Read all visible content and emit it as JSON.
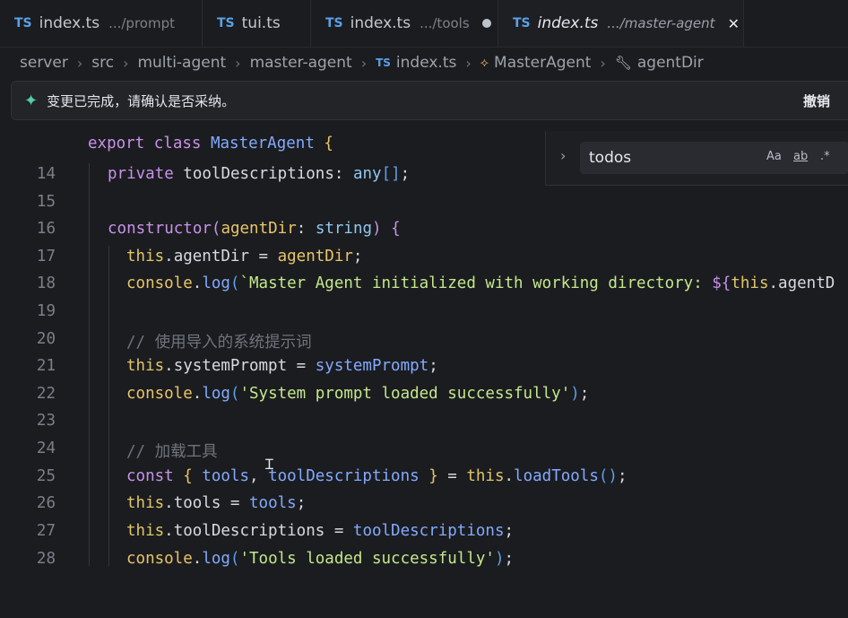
{
  "tabs": [
    {
      "name": "index.ts",
      "path": ".../prompt",
      "active": false
    },
    {
      "name": "tui.ts",
      "path": "",
      "active": false
    },
    {
      "name": "index.ts",
      "path": ".../tools",
      "active": false,
      "modified": true
    },
    {
      "name": "index.ts",
      "path": ".../master-agent",
      "active": true
    }
  ],
  "ts_badge": "TS",
  "close_glyph": "✕",
  "breadcrumb": {
    "items": [
      "server",
      "src",
      "multi-agent",
      "master-agent"
    ],
    "file": "index.ts",
    "class": "MasterAgent",
    "member": "agentDir",
    "class_icon": "symbol-class-icon",
    "member_icon": "wrench-icon"
  },
  "notice": {
    "text": "变更已完成，请确认是否采纳。",
    "undo": "撤销"
  },
  "find": {
    "query": "todos",
    "match_case": "Aa",
    "whole_word": "ab",
    "regex": ".*"
  },
  "code": {
    "sticky": "export class MasterAgent {",
    "lines": [
      {
        "n": "14",
        "text": "private toolDescriptions: any[];"
      },
      {
        "n": "15",
        "text": ""
      },
      {
        "n": "16",
        "text": "constructor(agentDir: string) {"
      },
      {
        "n": "17",
        "text": "this.agentDir = agentDir;"
      },
      {
        "n": "18",
        "text": "console.log(`Master Agent initialized with working directory: ${this.agentD"
      },
      {
        "n": "19",
        "text": ""
      },
      {
        "n": "20",
        "text": "// 使用导入的系统提示词"
      },
      {
        "n": "21",
        "text": "this.systemPrompt = systemPrompt;"
      },
      {
        "n": "22",
        "text": "console.log('System prompt loaded successfully');"
      },
      {
        "n": "23",
        "text": ""
      },
      {
        "n": "24",
        "text": "// 加载工具"
      },
      {
        "n": "25",
        "text": "const { tools, toolDescriptions } = this.loadTools();"
      },
      {
        "n": "26",
        "text": "this.tools = tools;"
      },
      {
        "n": "27",
        "text": "this.toolDescriptions = toolDescriptions;"
      },
      {
        "n": "28",
        "text": "console.log('Tools loaded successfully');"
      }
    ]
  }
}
